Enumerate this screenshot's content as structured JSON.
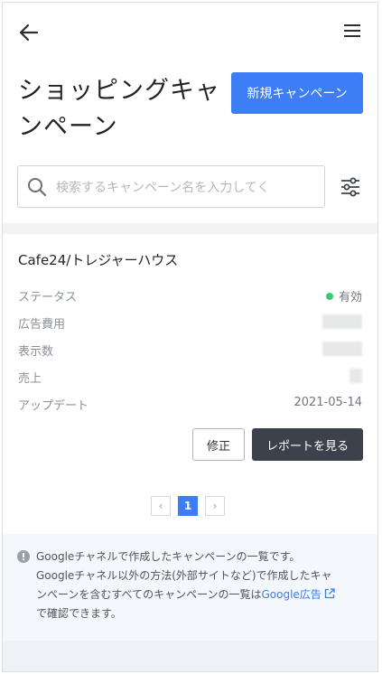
{
  "header": {
    "back_icon": "arrow-left-icon",
    "menu_icon": "hamburger-menu-icon"
  },
  "page": {
    "title": "ショッピングキャンペーン",
    "new_campaign_label": "新規キャンペーン"
  },
  "search": {
    "placeholder": "検索するキャンペーン名を入力してく",
    "value": "",
    "filter_icon": "sliders-icon"
  },
  "campaign": {
    "name": "Cafe24/トレジャーハウス",
    "fields": {
      "status_label": "ステータス",
      "status_value": "有効",
      "status_color": "#3fca72",
      "ad_cost_label": "広告費用",
      "impressions_label": "表示数",
      "sales_label": "売上",
      "updated_label": "アップデート",
      "updated_value": "2021-05-14"
    },
    "edit_label": "修正",
    "report_label": "レポートを見る"
  },
  "pagination": {
    "prev": "‹",
    "current": "1",
    "next": "›"
  },
  "notice": {
    "line1": "Googleチャネルで作成したキャンペーンの一覧です。",
    "line2": "Googleチャネル以外の方法(外部サイトなど)で作成したキャ",
    "line3_pre": "ンペーンを含むすべてのキャンペーンの一覧は",
    "link_text": "Google広告",
    "line4": "で確認できます。"
  },
  "colors": {
    "primary": "#3d7df6",
    "dark_button": "#3c424c"
  }
}
